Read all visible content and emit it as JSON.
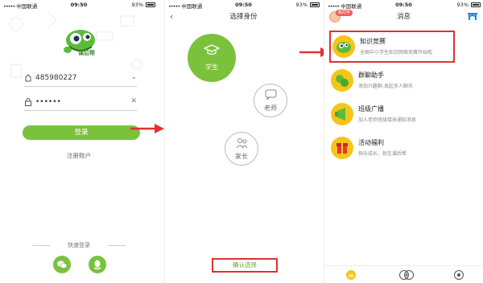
{
  "status_bar": {
    "signal_dots": "•••••",
    "carrier": "中国联通",
    "time": "09:50",
    "battery_p1": "93%",
    "battery_p2": "93%",
    "battery_p3": "93%"
  },
  "login": {
    "logo_text": "课后帮",
    "account_value": "485980227",
    "password_value": "••••••",
    "login_button": "登录",
    "register_link": "注册账户",
    "quick_login_label": "快速登录"
  },
  "role_select": {
    "title": "选择身份",
    "back": "‹",
    "student": "学生",
    "teacher": "老师",
    "parent": "家长",
    "confirm_button": "确认选择"
  },
  "messages": {
    "title": "消息",
    "badge": "新同学",
    "items": [
      {
        "title": "知识竞赛",
        "subtitle": "全国中小学生知识网络竞赛开始啦"
      },
      {
        "title": "群聊助手",
        "subtitle": "添加兴趣群,发起多人聊天"
      },
      {
        "title": "班级广播",
        "subtitle": "加入老师班级接收通知消息"
      },
      {
        "title": "活动福利",
        "subtitle": "快乐成长、就在课后帮"
      }
    ]
  },
  "colors": {
    "brand_green": "#7bc23c",
    "highlight_red": "#e03131",
    "icon_yellow": "#f5c518"
  },
  "icons": [
    "lock-icon",
    "user-icon",
    "wechat-icon",
    "qq-icon",
    "graduation-cap-icon",
    "chat-icon",
    "parent-icon",
    "bridge-icon",
    "home-tab-icon",
    "add-tab-icon",
    "profile-tab-icon",
    "chevron-down-icon",
    "clear-icon",
    "arrow-right-icon"
  ]
}
